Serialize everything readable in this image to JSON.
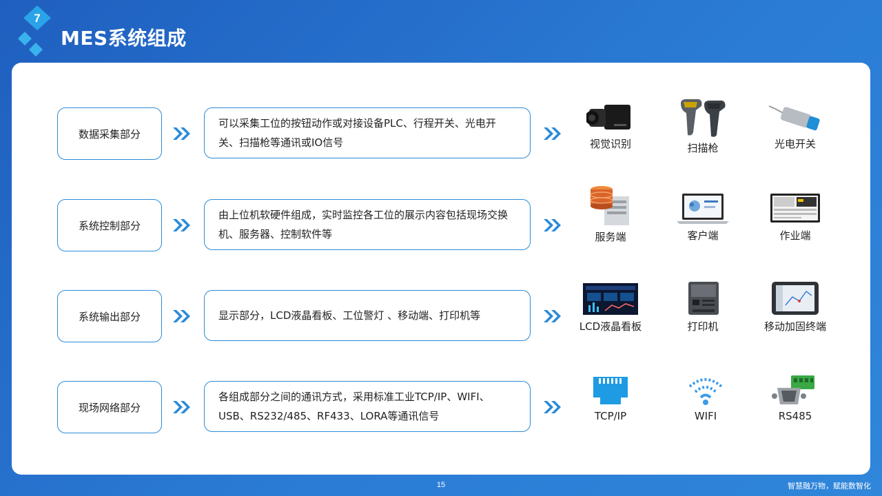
{
  "header": {
    "section_number": "7",
    "title": "MES系统组成"
  },
  "rows": [
    {
      "label": "数据采集部分",
      "description": "可以采集工位的按钮动作或对接设备PLC、行程开关、光电开关、扫描枪等通讯或IO信号",
      "items": [
        {
          "label": "视觉识别",
          "icon": "industrial-camera"
        },
        {
          "label": "扫描枪",
          "icon": "barcode-scanner"
        },
        {
          "label": "光电开关",
          "icon": "photoelectric-sensor"
        }
      ]
    },
    {
      "label": "系统控制部分",
      "description": "由上位机软硬件组成，实时监控各工位的展示内容包括现场交换机、服务器、控制软件等",
      "items": [
        {
          "label": "服务端",
          "icon": "server"
        },
        {
          "label": "客户端",
          "icon": "laptop"
        },
        {
          "label": "作业端",
          "icon": "monitor"
        }
      ]
    },
    {
      "label": "系统输出部分",
      "description": "显示部分，LCD液晶看板、工位警灯 、移动端、打印机等",
      "items": [
        {
          "label": "LCD液晶看板",
          "icon": "lcd-board"
        },
        {
          "label": "打印机",
          "icon": "label-printer"
        },
        {
          "label": "移动加固终端",
          "icon": "rugged-tablet"
        }
      ]
    },
    {
      "label": "现场网络部分",
      "description": "各组成部分之间的通讯方式，采用标准工业TCP/IP、WIFI、USB、RS232/485、RF433、LORA等通讯信号",
      "items": [
        {
          "label": "TCP/IP",
          "icon": "ethernet-port"
        },
        {
          "label": "WIFI",
          "icon": "wifi"
        },
        {
          "label": "RS485",
          "icon": "serial-connector"
        }
      ]
    }
  ],
  "footer": {
    "page_number": "15",
    "tagline": "智慧融万物，赋能数智化"
  },
  "colors": {
    "background": "#1f5fbf",
    "accent": "#2a8ad8",
    "card": "#ffffff",
    "text": "#222222"
  }
}
